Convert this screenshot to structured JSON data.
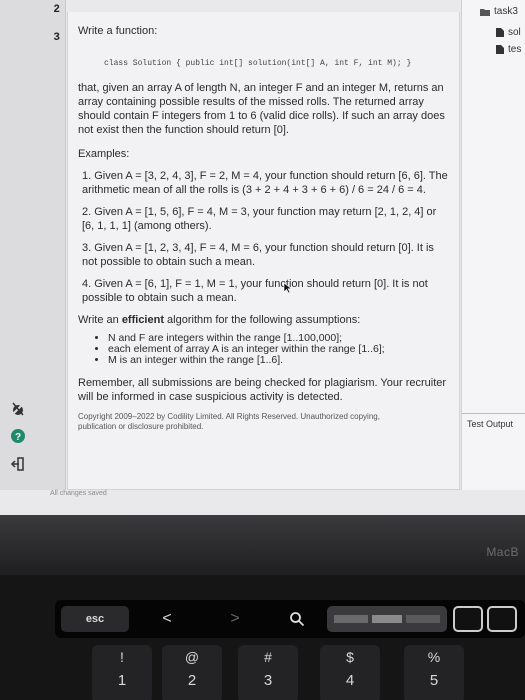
{
  "gutter": {
    "line_numbers": [
      "2",
      "3"
    ]
  },
  "description": {
    "title": "Write a function:",
    "code_signature": "class Solution { public int[] solution(int[] A, int F, int M); }",
    "intro": "that, given an array A of length N, an integer F and an integer M, returns an array containing possible results of the missed rolls. The returned array should contain F integers from 1 to 6 (valid dice rolls). If such an array does not exist then the function should return [0].",
    "examples_heading": "Examples:",
    "examples": [
      "1. Given A = [3, 2, 4, 3], F = 2, M = 4, your function should return [6, 6]. The arithmetic mean of all the rolls is (3 + 2 + 4 + 3 + 6 + 6) / 6 = 24 / 6 = 4.",
      "2. Given A = [1, 5, 6], F = 4, M = 3, your function may return [2, 1, 2, 4] or [6, 1, 1, 1] (among others).",
      "3. Given A = [1, 2, 3, 4], F = 4, M = 6, your function should return [0]. It is not possible to obtain such a mean.",
      "4. Given A = [6, 1], F = 1, M = 1, your function should return [0]. It is not possible to obtain such a mean."
    ],
    "assumptions_pre": "Write an ",
    "assumptions_bold": "efficient",
    "assumptions_post": " algorithm for the following assumptions:",
    "assumptions": [
      "N and F are integers within the range [1..100,000];",
      "each element of array A is an integer within the range [1..6];",
      "M is an integer within the range [1..6]."
    ],
    "remember": "Remember, all submissions are being checked for plagiarism. Your recruiter will be informed in case suspicious activity is detected.",
    "copyright": "Copyright 2009–2022 by Codility Limited. All Rights Reserved. Unauthorized copying, publication or disclosure prohibited."
  },
  "status": {
    "saved": "All changes saved"
  },
  "file_tree": {
    "root": "task3",
    "files": [
      "sol",
      "tes"
    ]
  },
  "test_output": {
    "label": "Test Output"
  },
  "bezel": {
    "brand": "MacB"
  },
  "touchbar": {
    "esc": "esc",
    "back": "<",
    "forward": ">"
  },
  "keys": [
    {
      "top": "!",
      "bottom": "1"
    },
    {
      "top": "@",
      "bottom": "2"
    },
    {
      "top": "#",
      "bottom": "3"
    },
    {
      "top": "$",
      "bottom": "4"
    },
    {
      "top": "%",
      "bottom": "5"
    }
  ],
  "colors": {
    "screen_bg": "#e9e9eb",
    "panel_bg": "#f2f2f4",
    "text": "#2b2b2b",
    "keyboard": "#151516"
  }
}
